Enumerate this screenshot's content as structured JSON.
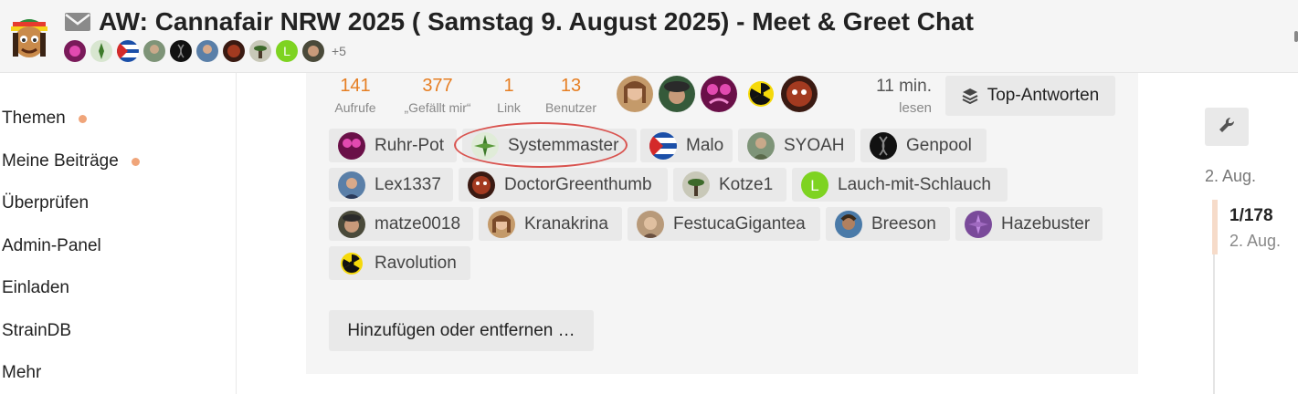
{
  "header": {
    "title": "AW: Cannafair NRW 2025 ( Samstag 9. August 2025) - Meet & Greet Chat",
    "more_participants": "+5"
  },
  "sidebar": {
    "items": [
      {
        "label": "Themen",
        "has_dot": true
      },
      {
        "label": "Meine Beiträge",
        "has_dot": true
      },
      {
        "label": "Überprüfen",
        "has_dot": false
      },
      {
        "label": "Admin-Panel",
        "has_dot": false
      },
      {
        "label": "Einladen",
        "has_dot": false
      },
      {
        "label": "StrainDB",
        "has_dot": false
      },
      {
        "label": "Mehr",
        "has_dot": false
      }
    ]
  },
  "topic_map": {
    "stats": [
      {
        "value": "141",
        "label": "Aufrufe"
      },
      {
        "value": "377",
        "label": "„Gefällt mir“"
      },
      {
        "value": "1",
        "label": "Link"
      },
      {
        "value": "13",
        "label": "Benutzer"
      }
    ],
    "read_time": {
      "value": "11 min.",
      "label": "lesen"
    },
    "top_replies_label": "Top-Antworten",
    "participants": [
      "Ruhr-Pot",
      "Systemmaster",
      "Malo",
      "SYOAH",
      "Genpool",
      "Lex1337",
      "DoctorGreenthumb",
      "Kotze1",
      "Lauch-mit-Schlauch",
      "matze0018",
      "Kranakrina",
      "FestucaGigantea",
      "Breeson",
      "Hazebuster",
      "Ravolution"
    ],
    "highlighted_participant": "Systemmaster",
    "add_remove_label": "Hinzufügen oder entfernen …"
  },
  "timeline": {
    "top_date": "2. Aug.",
    "position": "1/178",
    "handle_date": "2. Aug."
  },
  "colors": {
    "stat_number": "#e67e22",
    "nav_dot": "#f0a57a",
    "highlight_ring": "#d9534f",
    "timeline_handle": "#f6dbc9"
  }
}
